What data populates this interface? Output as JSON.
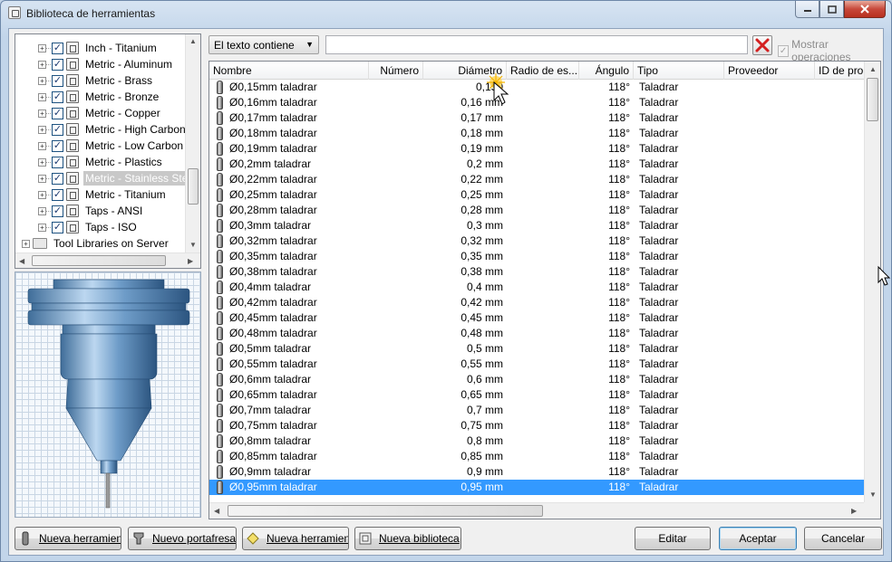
{
  "window": {
    "title": "Biblioteca de herramientas"
  },
  "tree": {
    "items": [
      {
        "label": "Inch - Titanium",
        "checked": true,
        "selected": false
      },
      {
        "label": "Metric - Aluminum",
        "checked": true,
        "selected": false
      },
      {
        "label": "Metric - Brass",
        "checked": true,
        "selected": false
      },
      {
        "label": "Metric - Bronze",
        "checked": true,
        "selected": false
      },
      {
        "label": "Metric - Copper",
        "checked": true,
        "selected": false
      },
      {
        "label": "Metric - High Carbon Ste",
        "checked": true,
        "selected": false
      },
      {
        "label": "Metric - Low Carbon Ste",
        "checked": true,
        "selected": false
      },
      {
        "label": "Metric - Plastics",
        "checked": true,
        "selected": false
      },
      {
        "label": "Metric - Stainless Steel",
        "checked": true,
        "selected": true
      },
      {
        "label": "Metric - Titanium",
        "checked": true,
        "selected": false
      },
      {
        "label": "Taps - ANSI",
        "checked": true,
        "selected": false
      },
      {
        "label": "Taps - ISO",
        "checked": true,
        "selected": false
      }
    ],
    "server_label": "Tool Libraries on Server"
  },
  "filter": {
    "mode": "El texto contiene",
    "search_value": "",
    "show_operations": "Mostrar operaciones"
  },
  "table": {
    "columns": [
      "Nombre",
      "Número",
      "Diámetro",
      "Radio de es...",
      "Ángulo",
      "Tipo",
      "Proveedor",
      "ID de pro..."
    ],
    "rows": [
      {
        "name": "Ø0,15mm taladrar",
        "diameter": "0,150",
        "angle": "118°",
        "type": "Taladrar"
      },
      {
        "name": "Ø0,16mm taladrar",
        "diameter": "0,16 mm",
        "angle": "118°",
        "type": "Taladrar"
      },
      {
        "name": "Ø0,17mm taladrar",
        "diameter": "0,17 mm",
        "angle": "118°",
        "type": "Taladrar"
      },
      {
        "name": "Ø0,18mm taladrar",
        "diameter": "0,18 mm",
        "angle": "118°",
        "type": "Taladrar"
      },
      {
        "name": "Ø0,19mm taladrar",
        "diameter": "0,19 mm",
        "angle": "118°",
        "type": "Taladrar"
      },
      {
        "name": "Ø0,2mm taladrar",
        "diameter": "0,2 mm",
        "angle": "118°",
        "type": "Taladrar"
      },
      {
        "name": "Ø0,22mm taladrar",
        "diameter": "0,22 mm",
        "angle": "118°",
        "type": "Taladrar"
      },
      {
        "name": "Ø0,25mm taladrar",
        "diameter": "0,25 mm",
        "angle": "118°",
        "type": "Taladrar"
      },
      {
        "name": "Ø0,28mm taladrar",
        "diameter": "0,28 mm",
        "angle": "118°",
        "type": "Taladrar"
      },
      {
        "name": "Ø0,3mm taladrar",
        "diameter": "0,3 mm",
        "angle": "118°",
        "type": "Taladrar"
      },
      {
        "name": "Ø0,32mm taladrar",
        "diameter": "0,32 mm",
        "angle": "118°",
        "type": "Taladrar"
      },
      {
        "name": "Ø0,35mm taladrar",
        "diameter": "0,35 mm",
        "angle": "118°",
        "type": "Taladrar"
      },
      {
        "name": "Ø0,38mm taladrar",
        "diameter": "0,38 mm",
        "angle": "118°",
        "type": "Taladrar"
      },
      {
        "name": "Ø0,4mm taladrar",
        "diameter": "0,4 mm",
        "angle": "118°",
        "type": "Taladrar"
      },
      {
        "name": "Ø0,42mm taladrar",
        "diameter": "0,42 mm",
        "angle": "118°",
        "type": "Taladrar"
      },
      {
        "name": "Ø0,45mm taladrar",
        "diameter": "0,45 mm",
        "angle": "118°",
        "type": "Taladrar"
      },
      {
        "name": "Ø0,48mm taladrar",
        "diameter": "0,48 mm",
        "angle": "118°",
        "type": "Taladrar"
      },
      {
        "name": "Ø0,5mm taladrar",
        "diameter": "0,5 mm",
        "angle": "118°",
        "type": "Taladrar"
      },
      {
        "name": "Ø0,55mm taladrar",
        "diameter": "0,55 mm",
        "angle": "118°",
        "type": "Taladrar"
      },
      {
        "name": "Ø0,6mm taladrar",
        "diameter": "0,6 mm",
        "angle": "118°",
        "type": "Taladrar"
      },
      {
        "name": "Ø0,65mm taladrar",
        "diameter": "0,65 mm",
        "angle": "118°",
        "type": "Taladrar"
      },
      {
        "name": "Ø0,7mm taladrar",
        "diameter": "0,7 mm",
        "angle": "118°",
        "type": "Taladrar"
      },
      {
        "name": "Ø0,75mm taladrar",
        "diameter": "0,75 mm",
        "angle": "118°",
        "type": "Taladrar"
      },
      {
        "name": "Ø0,8mm taladrar",
        "diameter": "0,8 mm",
        "angle": "118°",
        "type": "Taladrar"
      },
      {
        "name": "Ø0,85mm taladrar",
        "diameter": "0,85 mm",
        "angle": "118°",
        "type": "Taladrar"
      },
      {
        "name": "Ø0,9mm taladrar",
        "diameter": "0,9 mm",
        "angle": "118°",
        "type": "Taladrar"
      },
      {
        "name": "Ø0,95mm taladrar",
        "diameter": "0,95 mm",
        "angle": "118°",
        "type": "Taladrar"
      }
    ],
    "selected_row": 26
  },
  "buttons": {
    "new_tool": "Nueva herramienta",
    "new_holder": "Nuevo portafresas",
    "new_tool_2": "Nueva herramienta",
    "new_library": "Nueva biblioteca",
    "edit": "Editar",
    "accept": "Aceptar",
    "cancel": "Cancelar"
  },
  "colors": {
    "selection": "#3399ff",
    "tree_selection": "#c8c8c8",
    "clear_icon": "#d42020",
    "preview_tool": "#6a9ac8"
  }
}
